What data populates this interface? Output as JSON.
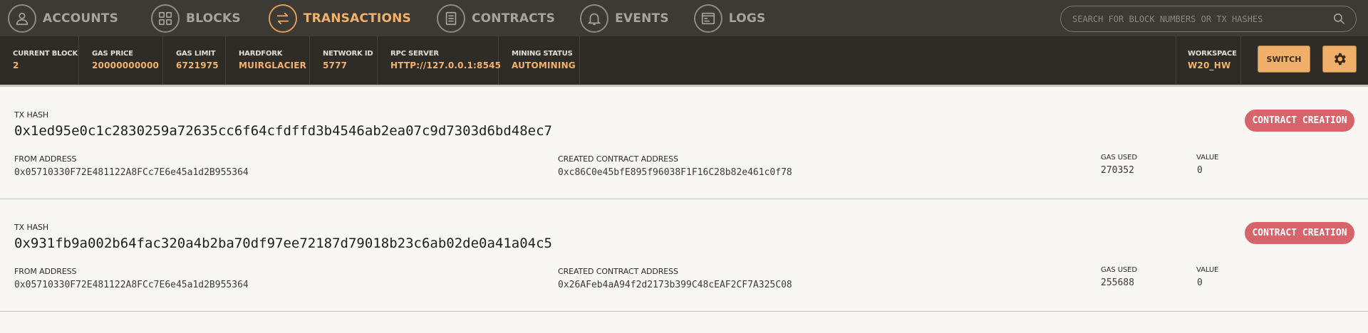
{
  "nav": {
    "items": [
      {
        "label": "ACCOUNTS",
        "icon": "person-icon",
        "active": false
      },
      {
        "label": "BLOCKS",
        "icon": "grid-icon",
        "active": false
      },
      {
        "label": "TRANSACTIONS",
        "icon": "swap-arrows-icon",
        "active": true
      },
      {
        "label": "CONTRACTS",
        "icon": "document-icon",
        "active": false
      },
      {
        "label": "EVENTS",
        "icon": "bell-icon",
        "active": false
      },
      {
        "label": "LOGS",
        "icon": "terminal-icon",
        "active": false
      }
    ],
    "search_placeholder": "SEARCH FOR BLOCK NUMBERS OR TX HASHES"
  },
  "status": {
    "current_block": {
      "label": "CURRENT BLOCK",
      "value": "2"
    },
    "gas_price": {
      "label": "GAS PRICE",
      "value": "20000000000"
    },
    "gas_limit": {
      "label": "GAS LIMIT",
      "value": "6721975"
    },
    "hardfork": {
      "label": "HARDFORK",
      "value": "MUIRGLACIER"
    },
    "network_id": {
      "label": "NETWORK ID",
      "value": "5777"
    },
    "rpc_server": {
      "label": "RPC SERVER",
      "value": "HTTP://127.0.0.1:8545"
    },
    "mining_status": {
      "label": "MINING STATUS",
      "value": "AUTOMINING"
    },
    "workspace": {
      "label": "WORKSPACE",
      "value": "W20_HW"
    },
    "switch_label": "SWITCH"
  },
  "transactions": [
    {
      "hash_label": "TX HASH",
      "hash": "0x1ed95e0c1c2830259a72635cc6f64cfdffd3b4546ab2ea07c9d7303d6bd48ec7",
      "badge": "CONTRACT CREATION",
      "from_label": "FROM ADDRESS",
      "from": "0x05710330F72E481122A8FCc7E6e45a1d2B955364",
      "created_label": "CREATED CONTRACT ADDRESS",
      "created": "0xc86C0e45bfE895f96038F1F16C28b82e461c0f78",
      "gas_label": "GAS USED",
      "gas": "270352",
      "value_label": "VALUE",
      "value": "0"
    },
    {
      "hash_label": "TX HASH",
      "hash": "0x931fb9a002b64fac320a4b2ba70df97ee72187d79018b23c6ab02de0a41a04c5",
      "badge": "CONTRACT CREATION",
      "from_label": "FROM ADDRESS",
      "from": "0x05710330F72E481122A8FCc7E6e45a1d2B955364",
      "created_label": "CREATED CONTRACT ADDRESS",
      "created": "0x26AFeb4aA94f2d2173b399C48cEAF2CF7A325C08",
      "gas_label": "GAS USED",
      "gas": "255688",
      "value_label": "VALUE",
      "value": "0"
    }
  ],
  "colors": {
    "nav_bg": "#3d3a35",
    "status_bg": "#2f2c28",
    "accent": "#f2b26b",
    "badge": "#d6646a",
    "content_bg": "#f8f7f3"
  }
}
